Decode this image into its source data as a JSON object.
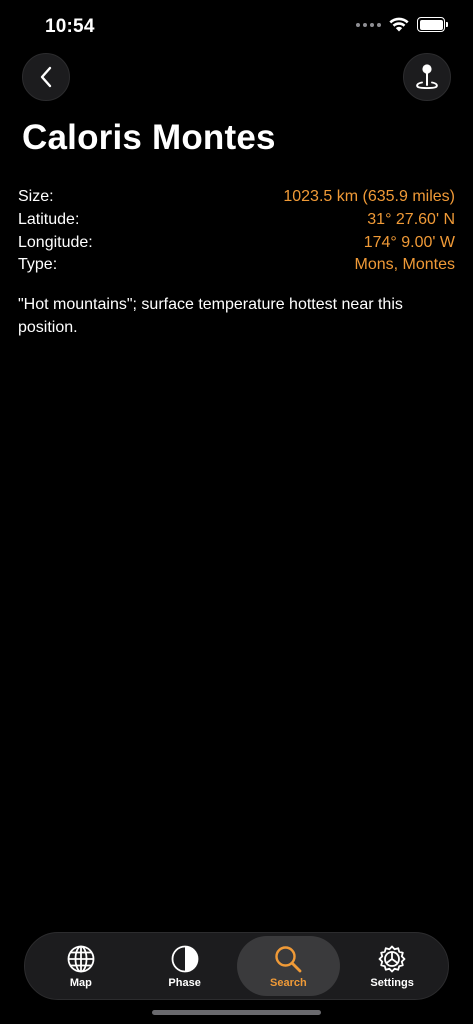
{
  "status_bar": {
    "time": "10:54",
    "icons": [
      "cellular-dots-icon",
      "wifi-icon",
      "battery-icon"
    ]
  },
  "nav": {
    "back_icon": "chevron-left-icon",
    "locate_icon": "map-pin-icon"
  },
  "feature": {
    "title": "Caloris Montes",
    "details": [
      {
        "label": "Size:",
        "value": "1023.5 km (635.9 miles)"
      },
      {
        "label": "Latitude:",
        "value": "31° 27.60' N"
      },
      {
        "label": "Longitude:",
        "value": "174° 9.00' W"
      },
      {
        "label": "Type:",
        "value": "Mons, Montes"
      }
    ],
    "description": "\"Hot mountains\"; surface temperature hottest near this position."
  },
  "tab_bar": {
    "tabs": [
      {
        "label": "Map",
        "icon": "globe-icon",
        "active": false
      },
      {
        "label": "Phase",
        "icon": "half-circle-icon",
        "active": false
      },
      {
        "label": "Search",
        "icon": "search-icon",
        "active": true
      },
      {
        "label": "Settings",
        "icon": "gear-icon",
        "active": false
      }
    ]
  },
  "colors": {
    "background": "#000000",
    "accent": "#f09a37",
    "surface": "#1c1c1e",
    "active_tab": "#3a3a3c"
  }
}
